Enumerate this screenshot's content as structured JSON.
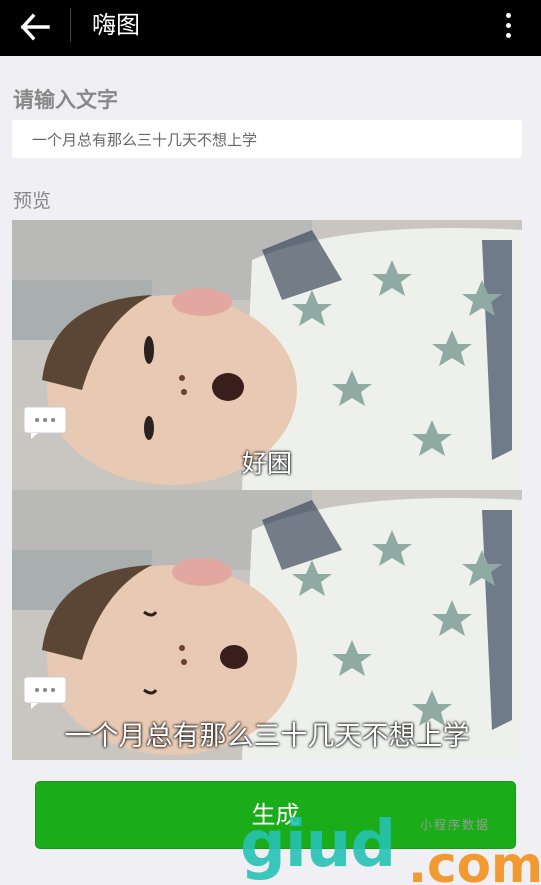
{
  "header": {
    "title": "嗨图",
    "back_icon": "arrow-left-icon",
    "menu_icon": "more-vertical-icon"
  },
  "form": {
    "input_label": "请输入文字",
    "input_value": "一个月总有那么三十几天不想上学",
    "preview_label": "预览"
  },
  "preview": {
    "frames": [
      {
        "caption": "好困",
        "bubble_icon": "chat-bubble-icon"
      },
      {
        "caption": "一个月总有那么三十几天不想上学",
        "bubble_icon": "chat-bubble-icon"
      }
    ]
  },
  "actions": {
    "generate_label": "生成"
  },
  "watermark": {
    "main": "giud",
    "suffix": ".com",
    "sub": "小程序数据"
  },
  "colors": {
    "header_bg": "#000000",
    "page_bg": "#efeff4",
    "primary_button": "#1aad19",
    "watermark_teal": "#27c2b4",
    "watermark_orange": "#f29a32"
  }
}
